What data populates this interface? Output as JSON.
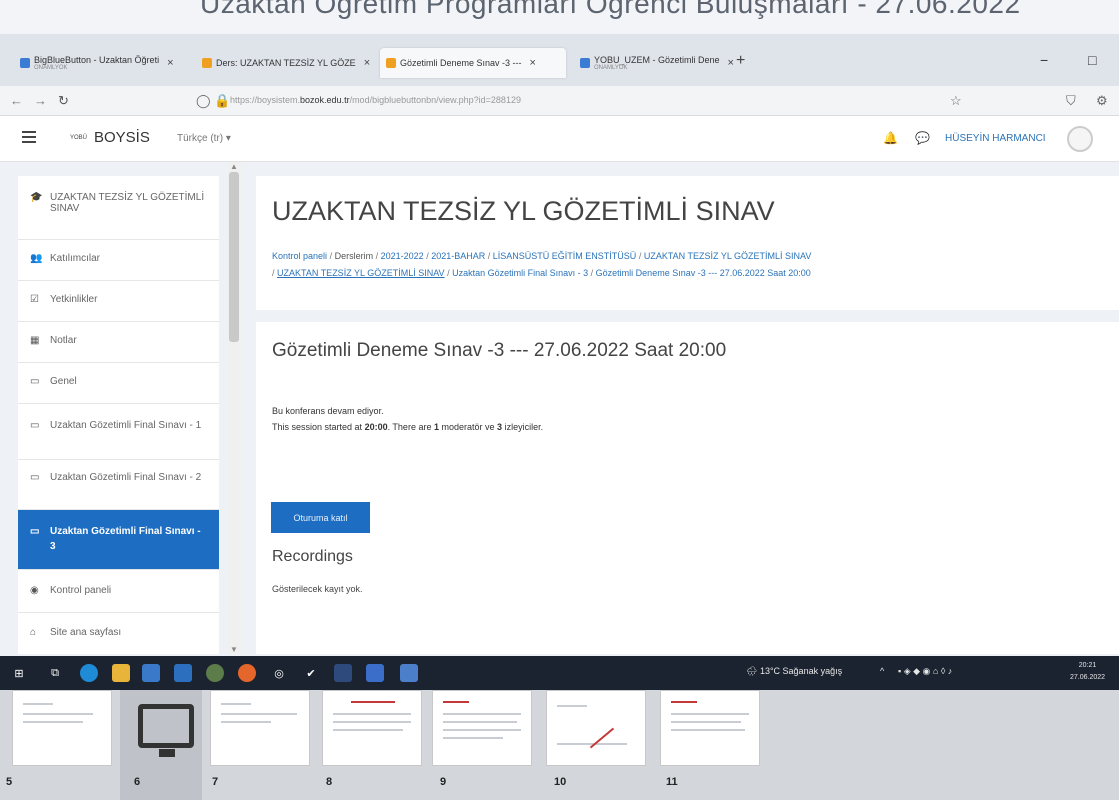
{
  "slide_caption": "Uzaktan Öğretim Programları Öğrenci Buluşmaları - 27.06.2022",
  "browser": {
    "tabs": [
      {
        "title": "BigBlueButton - Uzaktan Öğreti",
        "sub": "ONAMLYOK",
        "active": false
      },
      {
        "title": "Ders: UZAKTAN TEZSİZ YL GÖZE",
        "sub": "",
        "active": false
      },
      {
        "title": "Gözetimli Deneme Sınav -3 ---",
        "sub": "",
        "active": true
      },
      {
        "title": "YOBU_UZEM - Gözetimli Dene",
        "sub": "ONAMLYOK",
        "active": false
      }
    ],
    "new_tab": "+",
    "url_prefix": "https://boysistem.",
    "url_domain": "bozok.edu.tr",
    "url_path": "/mod/bigbluebuttonbn/view.php?id=288129"
  },
  "navbar": {
    "brand_small": "YOBÜ",
    "brand": "BOYSİS",
    "language": "Türkçe (tr) ▾",
    "user_name": "HÜSEYİN HARMANCI"
  },
  "sidebar": {
    "items": [
      {
        "label": "UZAKTAN TEZSİZ YL GÖZETİMLİ SINAV",
        "icon": "graduation-cap-icon",
        "glyph": "🎓"
      },
      {
        "label": "Katılımcılar",
        "icon": "users-icon",
        "glyph": "👥"
      },
      {
        "label": "Yetkinlikler",
        "icon": "checkbox-icon",
        "glyph": "☑"
      },
      {
        "label": "Notlar",
        "icon": "table-icon",
        "glyph": "▦"
      },
      {
        "label": "Genel",
        "icon": "folder-icon",
        "glyph": "▭"
      },
      {
        "label": "Uzaktan Gözetimli Final Sınavı - 1",
        "icon": "folder-icon",
        "glyph": "▭"
      },
      {
        "label": "Uzaktan Gözetimli Final Sınavı - 2",
        "icon": "folder-icon",
        "glyph": "▭"
      },
      {
        "label": "Uzaktan Gözetimli Final Sınavı - 3",
        "icon": "folder-icon",
        "glyph": "▭"
      },
      {
        "label": "Kontrol paneli",
        "icon": "dashboard-icon",
        "glyph": "◉"
      },
      {
        "label": "Site ana sayfası",
        "icon": "home-icon",
        "glyph": "⌂"
      }
    ]
  },
  "header": {
    "title": "UZAKTAN TEZSİZ YL GÖZETİMLİ SINAV",
    "breadcrumbs": [
      "Kontrol paneli",
      "Derslerim",
      "2021-2022",
      "2021-BAHAR",
      "LİSANSÜSTÜ EĞİTİM ENSTİTÜSÜ",
      "UZAKTAN TEZSİZ YL GÖZETİMLİ SINAV",
      "UZAKTAN TEZSİZ YL GÖZETİMLİ SINAV",
      "Uzaktan Gözetimli Final Sınavı - 3",
      "Gözetimli Deneme Sınav -3 --- 27.06.2022 Saat 20:00"
    ]
  },
  "content": {
    "session_title": "Gözetimli Deneme Sınav -3 --- 27.06.2022 Saat 20:00",
    "status": "Bu konferans devam ediyor.",
    "session_prefix": "This session started at",
    "start_time": "20:00",
    "there_are": ". There are",
    "moderators": "1",
    "moderator_label": "moderatör ve",
    "viewers": "3",
    "viewer_label": "izleyiciler.",
    "join_button": "Oturuma katıl",
    "recordings_title": "Recordings",
    "recordings_empty": "Gösterilecek kayıt yok."
  },
  "taskbar": {
    "weather": "13°C Sağanak yağış",
    "time": "20:21",
    "date": "27.06.2022"
  },
  "thumbnails": [
    "5",
    "6",
    "7",
    "8",
    "9",
    "10",
    "11"
  ]
}
